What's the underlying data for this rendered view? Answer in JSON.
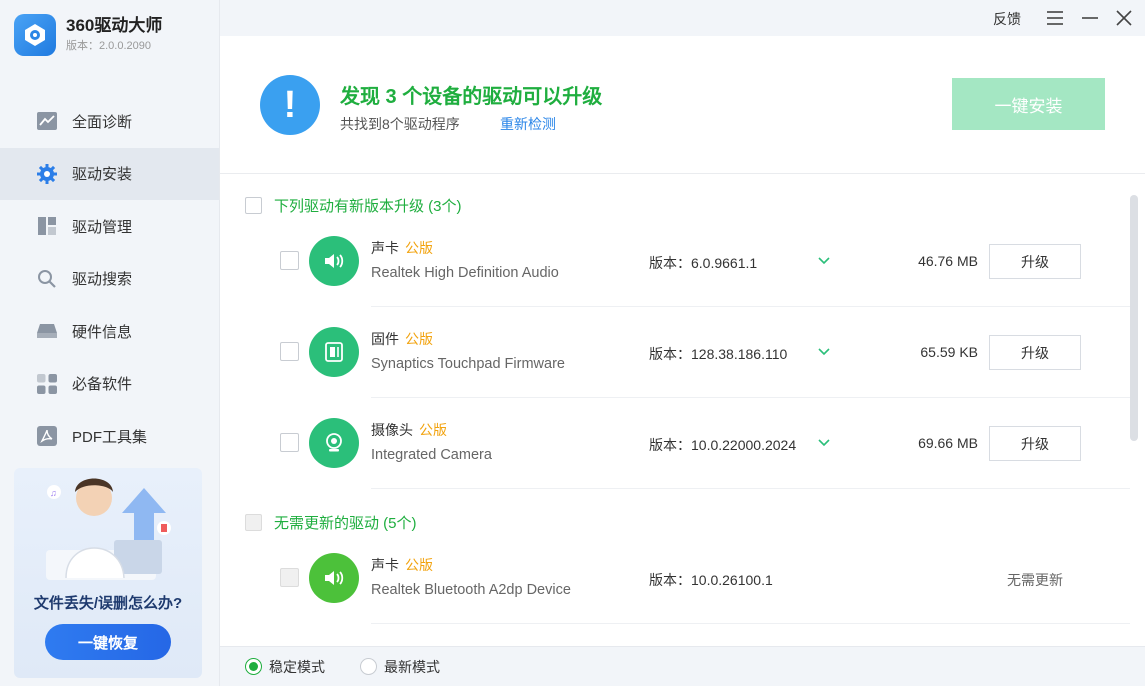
{
  "app": {
    "title": "360驱动大师",
    "version": "版本：2.0.0.2090"
  },
  "sidebar": {
    "items": [
      {
        "label": "全面诊断",
        "icon": "chart-icon"
      },
      {
        "label": "驱动安装",
        "icon": "gear-icon"
      },
      {
        "label": "驱动管理",
        "icon": "grid-icon"
      },
      {
        "label": "驱动搜索",
        "icon": "search-icon"
      },
      {
        "label": "硬件信息",
        "icon": "drive-icon"
      },
      {
        "label": "必备软件",
        "icon": "apps-icon"
      },
      {
        "label": "PDF工具集",
        "icon": "pdf-icon"
      }
    ],
    "promo": {
      "text": "文件丢失/误删怎么办?",
      "button": "一键恢复"
    }
  },
  "topbar": {
    "feedback": "反馈"
  },
  "header": {
    "title": "发现 3 个设备的驱动可以升级",
    "subtitle": "共找到8个驱动程序",
    "recheck": "重新检测",
    "install_button": "一键安装"
  },
  "sections": {
    "upgrade": {
      "label": "下列驱动有新版本升级 (3个)"
    },
    "uptodate": {
      "label": "无需更新的驱动 (5个)"
    }
  },
  "upgrade_rows": [
    {
      "category": "声卡",
      "tag": "公版",
      "name": "Realtek High Definition Audio",
      "version": "版本：6.0.9661.1",
      "size": "46.76 MB",
      "action": "升级",
      "icon": "speaker-icon"
    },
    {
      "category": "固件",
      "tag": "公版",
      "name": "Synaptics Touchpad Firmware",
      "version": "版本：128.38.186.110",
      "size": "65.59 KB",
      "action": "升级",
      "icon": "firmware-icon"
    },
    {
      "category": "摄像头",
      "tag": "公版",
      "name": "Integrated Camera",
      "version": "版本：10.0.22000.2024",
      "size": "69.66 MB",
      "action": "升级",
      "icon": "camera-icon"
    }
  ],
  "uptodate_rows": [
    {
      "category": "声卡",
      "tag": "公版",
      "name": "Realtek Bluetooth A2dp Device",
      "version": "版本：10.0.26100.1",
      "status": "无需更新",
      "icon": "speaker-icon"
    }
  ],
  "footer": {
    "mode_stable": "稳定模式",
    "mode_latest": "最新模式"
  },
  "colors": {
    "accent_green": "#1fae3f",
    "install_button": "#a4e7c3",
    "alert_blue": "#3aa0f0",
    "tag_orange": "#f2a30f",
    "link_blue": "#2b86e8"
  }
}
